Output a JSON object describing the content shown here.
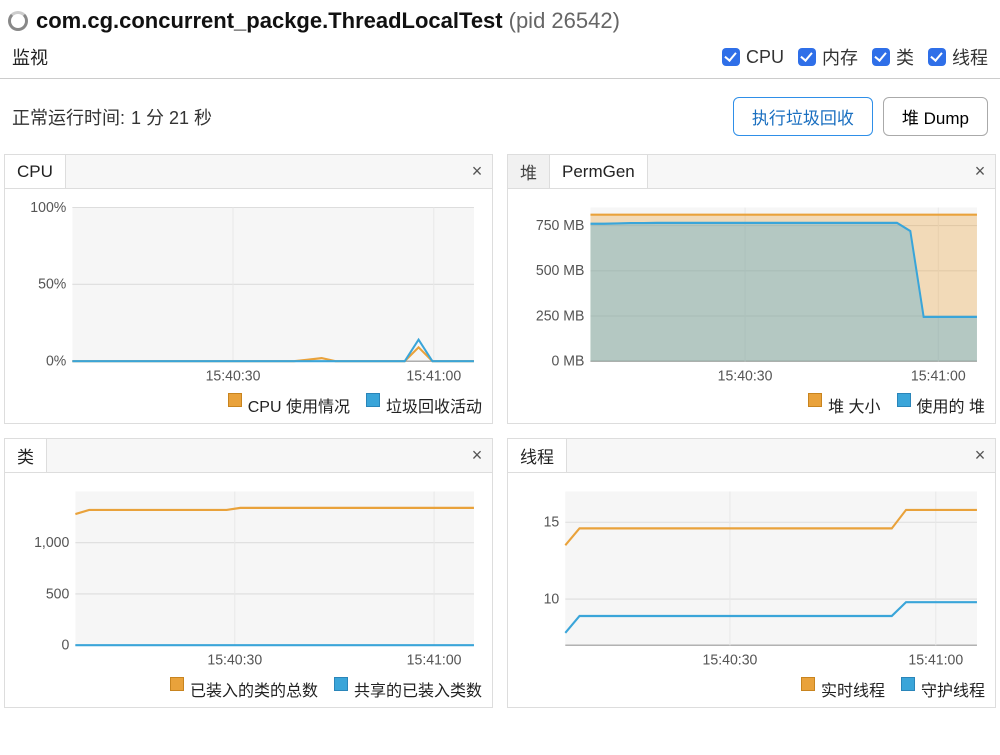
{
  "title": {
    "main": "com.cg.concurrent_packge.ThreadLocalTest",
    "pid_label": "(pid 26542)"
  },
  "monitor_tab": "监视",
  "checkboxes": {
    "cpu": "CPU",
    "memory": "内存",
    "classes": "类",
    "threads": "线程"
  },
  "uptime": {
    "label": "正常运行时间:",
    "value": "1 分 21 秒"
  },
  "buttons": {
    "gc": "执行垃圾回收",
    "heap_dump": "堆 Dump"
  },
  "panels": {
    "cpu": {
      "title": "CPU",
      "y_ticks": [
        "100%",
        "50%",
        "0%"
      ],
      "x_ticks": [
        "15:40:30",
        "15:41:00"
      ],
      "legend1": "CPU 使用情况",
      "legend2": "垃圾回收活动"
    },
    "heap": {
      "tab1": "堆",
      "tab2": "PermGen",
      "y_ticks": [
        "750 MB",
        "500 MB",
        "250 MB",
        "0 MB"
      ],
      "x_ticks": [
        "15:40:30",
        "15:41:00"
      ],
      "legend1": "堆 大小",
      "legend2": "使用的 堆"
    },
    "classes": {
      "title": "类",
      "y_ticks": [
        "1,000",
        "500",
        "0"
      ],
      "x_ticks": [
        "15:40:30",
        "15:41:00"
      ],
      "legend1": "已装入的类的总数",
      "legend2": "共享的已装入类数"
    },
    "threads": {
      "title": "线程",
      "y_ticks": [
        "15",
        "10"
      ],
      "x_ticks": [
        "15:40:30",
        "15:41:00"
      ],
      "legend1": "实时线程",
      "legend2": "守护线程"
    }
  },
  "chart_data": [
    {
      "type": "line",
      "title": "CPU",
      "xlabel": "",
      "ylabel": "",
      "ylim": [
        0,
        100
      ],
      "x_ticks": [
        "15:40:30",
        "15:41:00"
      ],
      "series": [
        {
          "name": "CPU 使用情况",
          "color": "#e9a23b",
          "values": [
            0,
            0,
            0,
            0,
            0,
            0,
            0,
            0,
            0,
            0,
            0,
            0,
            0,
            0,
            0,
            0,
            0,
            1,
            2,
            0,
            0,
            0,
            0,
            0,
            0,
            9,
            0,
            0,
            0,
            0
          ]
        },
        {
          "name": "垃圾回收活动",
          "color": "#3aa5d9",
          "values": [
            0,
            0,
            0,
            0,
            0,
            0,
            0,
            0,
            0,
            0,
            0,
            0,
            0,
            0,
            0,
            0,
            0,
            0,
            0,
            0,
            0,
            0,
            0,
            0,
            0,
            14,
            0,
            0,
            0,
            0
          ]
        }
      ]
    },
    {
      "type": "area",
      "title": "堆",
      "xlabel": "",
      "ylabel": "MB",
      "ylim": [
        0,
        850
      ],
      "x_ticks": [
        "15:40:30",
        "15:41:00"
      ],
      "series": [
        {
          "name": "堆 大小",
          "color": "#e9a23b",
          "values": [
            810,
            810,
            810,
            810,
            810,
            810,
            810,
            810,
            810,
            810,
            810,
            810,
            810,
            810,
            810,
            810,
            810,
            810,
            810,
            810,
            810,
            810,
            810,
            810,
            810,
            810,
            810,
            810,
            810,
            810
          ]
        },
        {
          "name": "使用的 堆",
          "color": "#3aa5d9",
          "values": [
            760,
            760,
            762,
            764,
            764,
            765,
            765,
            765,
            765,
            765,
            765,
            765,
            765,
            765,
            765,
            765,
            765,
            765,
            765,
            765,
            765,
            765,
            765,
            765,
            720,
            245,
            245,
            245,
            245,
            245
          ]
        }
      ]
    },
    {
      "type": "line",
      "title": "类",
      "xlabel": "",
      "ylabel": "",
      "ylim": [
        0,
        1500
      ],
      "x_ticks": [
        "15:40:30",
        "15:41:00"
      ],
      "series": [
        {
          "name": "已装入的类的总数",
          "color": "#e9a23b",
          "values": [
            1280,
            1320,
            1320,
            1320,
            1320,
            1320,
            1320,
            1320,
            1320,
            1320,
            1320,
            1320,
            1340,
            1340,
            1340,
            1340,
            1340,
            1340,
            1340,
            1340,
            1340,
            1340,
            1340,
            1340,
            1340,
            1340,
            1340,
            1340,
            1340,
            1340
          ]
        },
        {
          "name": "共享的已装入类数",
          "color": "#3aa5d9",
          "values": [
            0,
            0,
            0,
            0,
            0,
            0,
            0,
            0,
            0,
            0,
            0,
            0,
            0,
            0,
            0,
            0,
            0,
            0,
            0,
            0,
            0,
            0,
            0,
            0,
            0,
            0,
            0,
            0,
            0,
            0
          ]
        }
      ]
    },
    {
      "type": "line",
      "title": "线程",
      "xlabel": "",
      "ylabel": "",
      "ylim": [
        7,
        17
      ],
      "x_ticks": [
        "15:40:30",
        "15:41:00"
      ],
      "series": [
        {
          "name": "实时线程",
          "color": "#e9a23b",
          "values": [
            13.5,
            14.6,
            14.6,
            14.6,
            14.6,
            14.6,
            14.6,
            14.6,
            14.6,
            14.6,
            14.6,
            14.6,
            14.6,
            14.6,
            14.6,
            14.6,
            14.6,
            14.6,
            14.6,
            14.6,
            14.6,
            14.6,
            14.6,
            14.6,
            15.8,
            15.8,
            15.8,
            15.8,
            15.8,
            15.8
          ]
        },
        {
          "name": "守护线程",
          "color": "#3aa5d9",
          "values": [
            7.8,
            8.9,
            8.9,
            8.9,
            8.9,
            8.9,
            8.9,
            8.9,
            8.9,
            8.9,
            8.9,
            8.9,
            8.9,
            8.9,
            8.9,
            8.9,
            8.9,
            8.9,
            8.9,
            8.9,
            8.9,
            8.9,
            8.9,
            8.9,
            9.8,
            9.8,
            9.8,
            9.8,
            9.8,
            9.8
          ]
        }
      ]
    }
  ]
}
